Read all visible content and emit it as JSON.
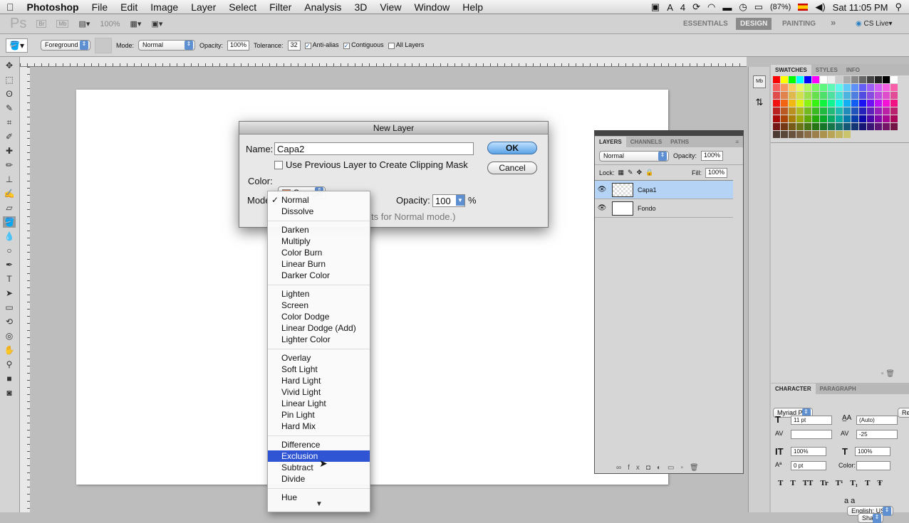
{
  "menubar": {
    "app": "Photoshop",
    "items": [
      "File",
      "Edit",
      "Image",
      "Layer",
      "Select",
      "Filter",
      "Analysis",
      "3D",
      "View",
      "Window",
      "Help"
    ],
    "status": {
      "adobe_count": "4",
      "battery": "(87%)",
      "clock": "Sat 11:05 PM"
    }
  },
  "appbar": {
    "logo": "Ps",
    "br": "Br",
    "mb": "Mb",
    "zoom": "100%",
    "workspaces": [
      "ESSENTIALS",
      "DESIGN",
      "PAINTING"
    ],
    "active_workspace": "DESIGN",
    "more": "»",
    "cs_live": "CS Live"
  },
  "options": {
    "fill": "Foreground",
    "mode_label": "Mode:",
    "mode": "Normal",
    "opacity_label": "Opacity:",
    "opacity": "100%",
    "tolerance_label": "Tolerance:",
    "tolerance": "32",
    "anti_alias": "Anti-alias",
    "anti_alias_checked": true,
    "contiguous": "Contiguous",
    "contiguous_checked": true,
    "all_layers": "All Layers",
    "all_layers_checked": false
  },
  "swatches": {
    "tabs": [
      "SWATCHES",
      "STYLES",
      "INFO"
    ]
  },
  "dialog": {
    "title": "New Layer",
    "name_label": "Name:",
    "name": "Capa2",
    "clip_label": "Use Previous Layer to Create Clipping Mask",
    "clip_checked": false,
    "color_label": "Color:",
    "color": "Orange",
    "color_hex": "#f08a5d",
    "mode_label": "Mode",
    "opacity_label": "Opacity:",
    "opacity": "100",
    "pct": "%",
    "note": "ts for Normal mode.)",
    "ok": "OK",
    "cancel": "Cancel"
  },
  "mode_menu": {
    "groups": [
      [
        "Normal",
        "Dissolve"
      ],
      [
        "Darken",
        "Multiply",
        "Color Burn",
        "Linear Burn",
        "Darker Color"
      ],
      [
        "Lighten",
        "Screen",
        "Color Dodge",
        "Linear Dodge (Add)",
        "Lighter Color"
      ],
      [
        "Overlay",
        "Soft Light",
        "Hard Light",
        "Vivid Light",
        "Linear Light",
        "Pin Light",
        "Hard Mix"
      ],
      [
        "Difference",
        "Exclusion",
        "Subtract",
        "Divide"
      ],
      [
        "Hue"
      ]
    ],
    "checked": "Normal",
    "highlighted": "Exclusion",
    "highlight_color": "#2f55d4"
  },
  "layers": {
    "tabs": [
      "LAYERS",
      "CHANNELS",
      "PATHS"
    ],
    "blend": "Normal",
    "opacity_label": "Opacity:",
    "opacity": "100%",
    "lock_label": "Lock:",
    "fill_label": "Fill:",
    "fill": "100%",
    "items": [
      {
        "name": "Capa1",
        "selected": true,
        "transparent": true
      },
      {
        "name": "Fondo",
        "selected": false,
        "transparent": false
      }
    ]
  },
  "character": {
    "tabs": [
      "CHARACTER",
      "PARAGRAPH"
    ],
    "font": "Myriad Pro",
    "style": "Regular",
    "size": "11 pt",
    "leading": "(Auto)",
    "kerning": "",
    "tracking": "-25",
    "vscale": "100%",
    "hscale": "100%",
    "baseline": "0 pt",
    "color_label": "Color:",
    "language": "English: USA",
    "aa_label": "a a",
    "antialias": "Sharp",
    "type_buttons": [
      "T",
      "T",
      "TT",
      "Tr",
      "T¹",
      "T₁",
      "T",
      "Ŧ"
    ]
  }
}
